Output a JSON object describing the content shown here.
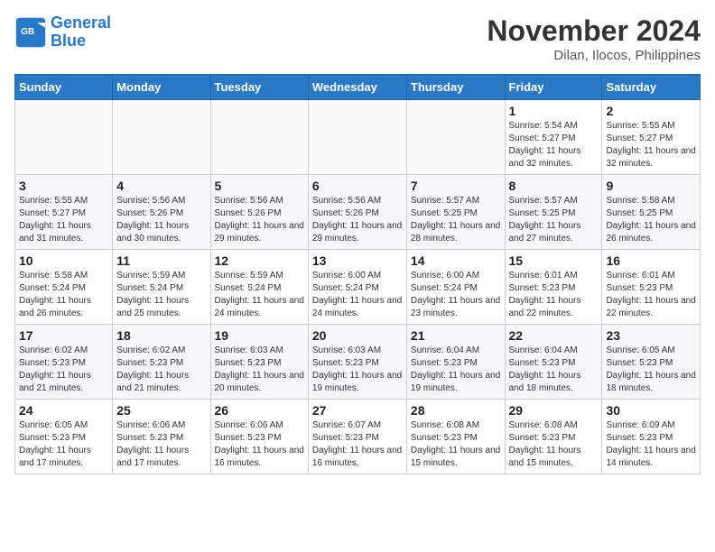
{
  "logo": {
    "text_general": "General",
    "text_blue": "Blue"
  },
  "header": {
    "month": "November 2024",
    "location": "Dilan, Ilocos, Philippines"
  },
  "days_of_week": [
    "Sunday",
    "Monday",
    "Tuesday",
    "Wednesday",
    "Thursday",
    "Friday",
    "Saturday"
  ],
  "weeks": [
    [
      {
        "day": "",
        "detail": ""
      },
      {
        "day": "",
        "detail": ""
      },
      {
        "day": "",
        "detail": ""
      },
      {
        "day": "",
        "detail": ""
      },
      {
        "day": "",
        "detail": ""
      },
      {
        "day": "1",
        "detail": "Sunrise: 5:54 AM\nSunset: 5:27 PM\nDaylight: 11 hours and 32 minutes."
      },
      {
        "day": "2",
        "detail": "Sunrise: 5:55 AM\nSunset: 5:27 PM\nDaylight: 11 hours and 32 minutes."
      }
    ],
    [
      {
        "day": "3",
        "detail": "Sunrise: 5:55 AM\nSunset: 5:27 PM\nDaylight: 11 hours and 31 minutes."
      },
      {
        "day": "4",
        "detail": "Sunrise: 5:56 AM\nSunset: 5:26 PM\nDaylight: 11 hours and 30 minutes."
      },
      {
        "day": "5",
        "detail": "Sunrise: 5:56 AM\nSunset: 5:26 PM\nDaylight: 11 hours and 29 minutes."
      },
      {
        "day": "6",
        "detail": "Sunrise: 5:56 AM\nSunset: 5:26 PM\nDaylight: 11 hours and 29 minutes."
      },
      {
        "day": "7",
        "detail": "Sunrise: 5:57 AM\nSunset: 5:25 PM\nDaylight: 11 hours and 28 minutes."
      },
      {
        "day": "8",
        "detail": "Sunrise: 5:57 AM\nSunset: 5:25 PM\nDaylight: 11 hours and 27 minutes."
      },
      {
        "day": "9",
        "detail": "Sunrise: 5:58 AM\nSunset: 5:25 PM\nDaylight: 11 hours and 26 minutes."
      }
    ],
    [
      {
        "day": "10",
        "detail": "Sunrise: 5:58 AM\nSunset: 5:24 PM\nDaylight: 11 hours and 26 minutes."
      },
      {
        "day": "11",
        "detail": "Sunrise: 5:59 AM\nSunset: 5:24 PM\nDaylight: 11 hours and 25 minutes."
      },
      {
        "day": "12",
        "detail": "Sunrise: 5:59 AM\nSunset: 5:24 PM\nDaylight: 11 hours and 24 minutes."
      },
      {
        "day": "13",
        "detail": "Sunrise: 6:00 AM\nSunset: 5:24 PM\nDaylight: 11 hours and 24 minutes."
      },
      {
        "day": "14",
        "detail": "Sunrise: 6:00 AM\nSunset: 5:24 PM\nDaylight: 11 hours and 23 minutes."
      },
      {
        "day": "15",
        "detail": "Sunrise: 6:01 AM\nSunset: 5:23 PM\nDaylight: 11 hours and 22 minutes."
      },
      {
        "day": "16",
        "detail": "Sunrise: 6:01 AM\nSunset: 5:23 PM\nDaylight: 11 hours and 22 minutes."
      }
    ],
    [
      {
        "day": "17",
        "detail": "Sunrise: 6:02 AM\nSunset: 5:23 PM\nDaylight: 11 hours and 21 minutes."
      },
      {
        "day": "18",
        "detail": "Sunrise: 6:02 AM\nSunset: 5:23 PM\nDaylight: 11 hours and 21 minutes."
      },
      {
        "day": "19",
        "detail": "Sunrise: 6:03 AM\nSunset: 5:23 PM\nDaylight: 11 hours and 20 minutes."
      },
      {
        "day": "20",
        "detail": "Sunrise: 6:03 AM\nSunset: 5:23 PM\nDaylight: 11 hours and 19 minutes."
      },
      {
        "day": "21",
        "detail": "Sunrise: 6:04 AM\nSunset: 5:23 PM\nDaylight: 11 hours and 19 minutes."
      },
      {
        "day": "22",
        "detail": "Sunrise: 6:04 AM\nSunset: 5:23 PM\nDaylight: 11 hours and 18 minutes."
      },
      {
        "day": "23",
        "detail": "Sunrise: 6:05 AM\nSunset: 5:23 PM\nDaylight: 11 hours and 18 minutes."
      }
    ],
    [
      {
        "day": "24",
        "detail": "Sunrise: 6:05 AM\nSunset: 5:23 PM\nDaylight: 11 hours and 17 minutes."
      },
      {
        "day": "25",
        "detail": "Sunrise: 6:06 AM\nSunset: 5:23 PM\nDaylight: 11 hours and 17 minutes."
      },
      {
        "day": "26",
        "detail": "Sunrise: 6:06 AM\nSunset: 5:23 PM\nDaylight: 11 hours and 16 minutes."
      },
      {
        "day": "27",
        "detail": "Sunrise: 6:07 AM\nSunset: 5:23 PM\nDaylight: 11 hours and 16 minutes."
      },
      {
        "day": "28",
        "detail": "Sunrise: 6:08 AM\nSunset: 5:23 PM\nDaylight: 11 hours and 15 minutes."
      },
      {
        "day": "29",
        "detail": "Sunrise: 6:08 AM\nSunset: 5:23 PM\nDaylight: 11 hours and 15 minutes."
      },
      {
        "day": "30",
        "detail": "Sunrise: 6:09 AM\nSunset: 5:23 PM\nDaylight: 11 hours and 14 minutes."
      }
    ]
  ]
}
